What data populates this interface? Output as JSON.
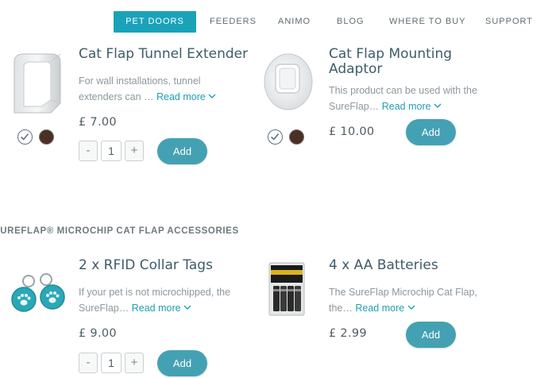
{
  "nav": {
    "items": [
      {
        "label": "PET DOORS",
        "active": true
      },
      {
        "label": "FEEDERS",
        "active": false
      },
      {
        "label": "ANIMO",
        "active": false
      },
      {
        "label": "BLOG",
        "active": false
      },
      {
        "label": "WHERE TO BUY",
        "active": false
      },
      {
        "label": "SUPPORT",
        "active": false
      }
    ]
  },
  "products": [
    {
      "title": "Cat Flap Tunnel Extender",
      "description": "For wall installations, tunnel extenders can …",
      "read_more": "Read more",
      "price": "£ 7.00",
      "quantity": "1",
      "add_label": "Add",
      "colours": [
        "white",
        "brown"
      ],
      "image": "tunnel-extender-image"
    },
    {
      "title": "Cat Flap Mounting Adaptor",
      "description": "This product can be used with the SureFlap…",
      "read_more": "Read more",
      "price": "£ 10.00",
      "add_label": "Add",
      "colours": [
        "white",
        "brown"
      ],
      "image": "mounting-adaptor-image"
    },
    {
      "title": "2 x RFID Collar Tags",
      "description": "If your pet is not microchipped, the SureFlap…",
      "read_more": "Read more",
      "price": "£ 9.00",
      "quantity": "1",
      "add_label": "Add",
      "image": "collar-tags-image"
    },
    {
      "title": "4 x AA Batteries",
      "description": "The SureFlap Microchip Cat Flap, the…",
      "read_more": "Read more",
      "price": "£ 2.99",
      "add_label": "Add",
      "image": "batteries-image"
    }
  ],
  "section_heading": "SUREFLAP® MICROCHIP CAT FLAP ACCESSORIES",
  "stepper": {
    "minus": "-",
    "plus": "+"
  },
  "colors": {
    "accent": "#1aa3b8",
    "add_button": "#44a1b3",
    "title": "#3d5c6a",
    "link": "#1f9fb3",
    "swatch_brown": "#4a2f24"
  }
}
